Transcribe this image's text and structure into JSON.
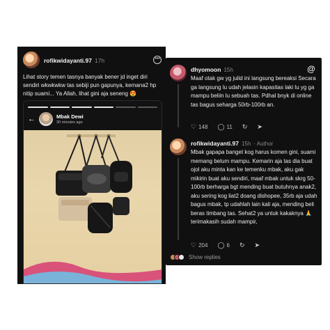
{
  "left_post": {
    "username": "rofikwidayanti.97",
    "time": "17h",
    "text": "Lihat story temen tasnya banyak bener jd inget diri sendiri wkwkwkw tas sebiji pun gapunya, kemana2 hp nitip suami... Ya Allah, lihat gini aja seneng",
    "emoji": "😍",
    "more_icon": "ellipsis-circle-icon",
    "story": {
      "name": "Mbak Dewi",
      "time": "30 minutes ago",
      "back_icon": "arrow-left-icon"
    }
  },
  "right_thread": {
    "app_icon": "threads-logo-icon",
    "replies": [
      {
        "username": "dhyomoon",
        "time": "15h",
        "author_tag": "",
        "text": "Maaf otak gw yg julid ini langsung bereaksi Secara ga langsung lu udah jelasin kapasitas laki lu yg ga mampu beliin lu sebuah tas. Pdhal bnyk di online tas bagus seharga 50rb-100rb an.",
        "likes": "148",
        "comments": "11",
        "avatar_color": "#c45a6a"
      },
      {
        "username": "rofikwidayanti.97",
        "time": "15h",
        "author_tag": "· Author",
        "text": "Mbak gapapa banget kog harus komen gini, suami memang belum mampu. Kemarin aja tas dia buat ojol aku minta kan ke temenku mbak, aku gak mikirin buat aku sendiri, maaf mbak untuk skrg 50-100rb berharga bgt mending buat butuhnya anak2, aku sering kog liat2 doang dishopee, 35rb aja udah bagus mbak, tp udahlah lain kali aja, mending beli beras timbang tas. Sehat2 ya untuk kakaknya",
        "emoji": "🙏",
        "text_end": "terimakasih sudah mampir,",
        "likes": "204",
        "comments": "6",
        "avatar_color": "#c98a5e"
      }
    ],
    "show_replies": "Show replies"
  },
  "colors": {
    "background": "#101010",
    "text": "#eeeeee",
    "muted": "#8a8a8a"
  }
}
